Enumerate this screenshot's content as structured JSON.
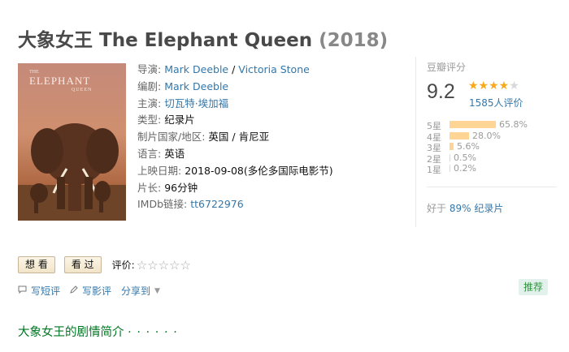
{
  "header": {
    "title": "大象女王 The Elephant Queen",
    "year": "(2018)"
  },
  "poster": {
    "top_text": "THE",
    "main_text": "ELEPHANT",
    "sub_text": "QUEEN"
  },
  "info": {
    "director_label": "导演:",
    "directors": [
      "Mark Deeble",
      "Victoria Stone"
    ],
    "director_sep": "/",
    "writer_label": "编剧:",
    "writer": "Mark Deeble",
    "cast_label": "主演:",
    "cast": "切瓦特·埃加福",
    "genre_label": "类型:",
    "genre": "纪录片",
    "country_label": "制片国家/地区:",
    "country": "英国 / 肯尼亚",
    "language_label": "语言:",
    "language": "英语",
    "release_label": "上映日期:",
    "release": "2018-09-08(多伦多国际电影节)",
    "runtime_label": "片长:",
    "runtime": "96分钟",
    "imdb_label": "IMDb链接:",
    "imdb": "tt6722976"
  },
  "rating": {
    "label": "豆瓣评分",
    "score": "9.2",
    "stars": 4.5,
    "votes": "1585人评价",
    "star_color": "#f7a91b",
    "bar_color": "#ffd596",
    "distribution": [
      {
        "label": "5星",
        "pct": "65.8%",
        "value": 65.8
      },
      {
        "label": "4星",
        "pct": "28.0%",
        "value": 28.0
      },
      {
        "label": "3星",
        "pct": "5.6%",
        "value": 5.6
      },
      {
        "label": "2星",
        "pct": "0.5%",
        "value": 0.5
      },
      {
        "label": "1星",
        "pct": "0.2%",
        "value": 0.2
      }
    ],
    "better_prefix": "好于",
    "better_link": "89% 纪录片"
  },
  "actions": {
    "want_label": "想 看",
    "seen_label": "看 过",
    "rate_label": "评价:",
    "empty_stars": "☆☆☆☆☆"
  },
  "links": {
    "short_review": "写短评",
    "review": "写影评",
    "share": "分享到",
    "short_review_icon": "comment-icon",
    "review_icon": "pencil-icon"
  },
  "recommend_label": "推荐",
  "synopsis": {
    "title": "大象女王的剧情简介",
    "dots": "· · · · · ·"
  }
}
